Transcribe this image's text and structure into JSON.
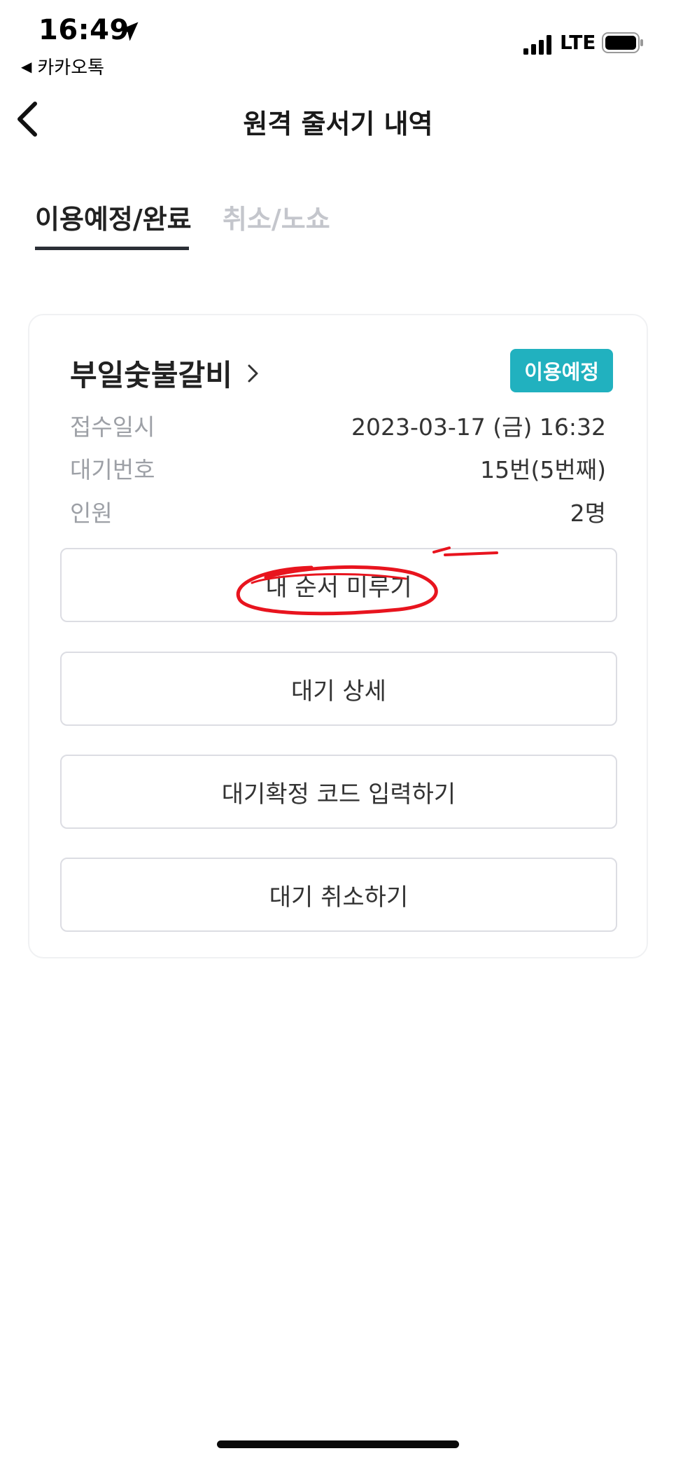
{
  "status_bar": {
    "time": "16:49",
    "back_app": "카카오톡",
    "network": "LTE"
  },
  "nav": {
    "title": "원격 줄서기 내역"
  },
  "tabs": [
    {
      "label": "이용예정/완료",
      "active": true
    },
    {
      "label": "취소/노쇼",
      "active": false
    }
  ],
  "card": {
    "store_name": "부일숯불갈비",
    "badge": "이용예정",
    "info": [
      {
        "label": "접수일시",
        "value": "2023-03-17 (금)  16:32"
      },
      {
        "label": "대기번호",
        "value": "15번(5번째)"
      },
      {
        "label": "인원",
        "value": "2명"
      }
    ],
    "buttons": {
      "postpone": "내 순서 미루기",
      "detail": "대기 상세",
      "confirm_code": "대기확정 코드 입력하기",
      "cancel": "대기 취소하기"
    }
  },
  "colors": {
    "badge_bg": "#21b1bf",
    "annotation": "#e8141e",
    "tab_inactive": "#c4c6cc"
  }
}
